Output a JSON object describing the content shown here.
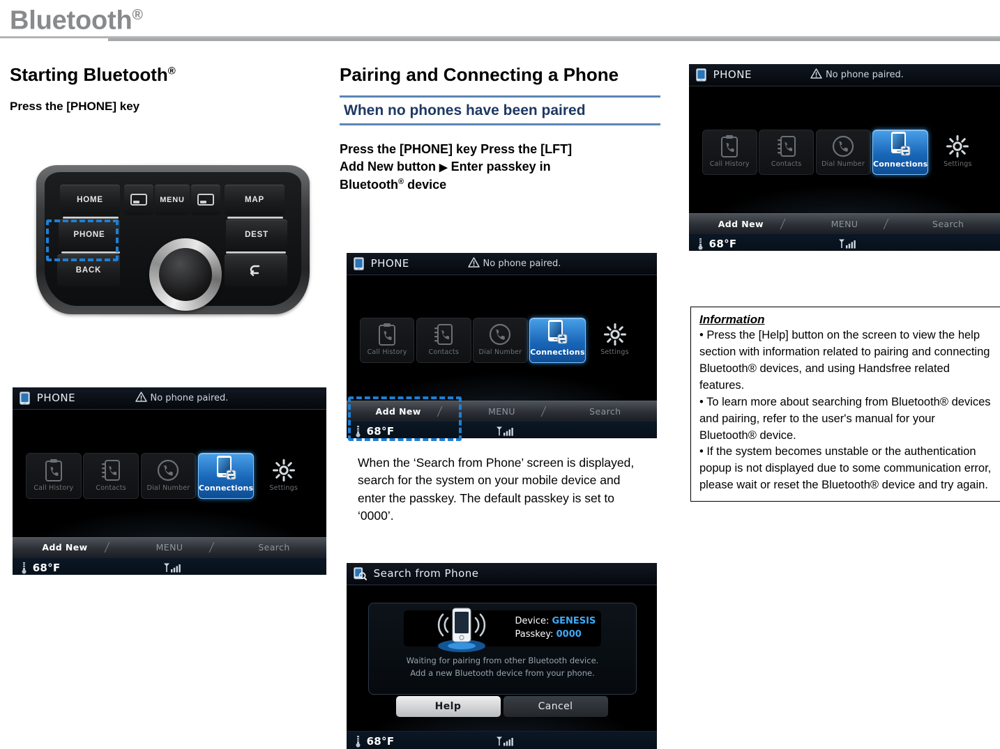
{
  "header": {
    "title": "Bluetooth",
    "reg": "®"
  },
  "left": {
    "heading": "Starting Bluetooth",
    "heading_reg": "®",
    "note": "Press the [PHONE] key",
    "car_panel": {
      "buttons": [
        {
          "label": "HOME",
          "name": "home-button"
        },
        {
          "label": "PHONE",
          "name": "phone-button",
          "highlighted": true
        },
        {
          "label": "BACK",
          "name": "back-button"
        },
        {
          "label": "MENU",
          "name": "menu-button"
        },
        {
          "label": "MAP",
          "name": "map-button"
        },
        {
          "label": "DEST",
          "name": "dest-button"
        }
      ],
      "highlight_color": "#1f7fd4"
    }
  },
  "middle": {
    "heading": "Pairing and Connecting a Phone",
    "section": "When no phones have been paired",
    "section_color": "#1f3864",
    "rule_color": "#5b85b5",
    "steps": "Press the [PHONE] key Press the [LFT] Add New button ▶ Enter passkey in Bluetooth® device",
    "steps_line1": "Press the [PHONE] key Press the [LFT]",
    "steps_line2a": "Add New button",
    "steps_arrow": "▶",
    "steps_line2b": "Enter passkey in",
    "steps_line3": "Bluetooth",
    "steps_line3_reg": "®",
    "steps_line3b": " device",
    "paragraph": "When the ‘Search from Phone’ screen is displayed, search for the system on your mobile device and enter the passkey. The default passkey is set to ‘0000’."
  },
  "right": {
    "info": {
      "title": "Information",
      "bullets": [
        "• Press the [Help] button on the screen to view the help section with information related to pairing and connecting Bluetooth® devices, and using Handsfree related features.",
        "• To learn more about searching from Bluetooth® devices and pairing, refer to the user's manual for your Bluetooth® device.",
        "• If the system becomes unstable or the authentication popup is not displayed due to some communication error, please wait or reset the Bluetooth® device and try again."
      ]
    }
  },
  "phone_screen": {
    "title": "PHONE",
    "warning": "No phone paired.",
    "tiles": [
      {
        "label": "Call History",
        "icon": "call-history-icon",
        "selected": false
      },
      {
        "label": "Contacts",
        "icon": "contacts-icon",
        "selected": false
      },
      {
        "label": "Dial Number",
        "icon": "dial-number-icon",
        "selected": false
      },
      {
        "label": "Connections",
        "icon": "connections-icon",
        "selected": true
      },
      {
        "label": "Settings",
        "icon": "settings-gear-icon",
        "selected": false
      }
    ],
    "softkeys": [
      {
        "label": "Add New",
        "active": true
      },
      {
        "label": "MENU",
        "active": false
      },
      {
        "label": "Search",
        "active": false
      }
    ],
    "status": {
      "temperature": "68°F",
      "signal": "signal-bars-icon"
    }
  },
  "search_screen": {
    "title": "Search from Phone",
    "device_label": "Device:",
    "device_value": "GENESIS",
    "passkey_label": "Passkey:",
    "passkey_value": "0000",
    "wait_line1": "Waiting for pairing from other Bluetooth device.",
    "wait_line2": "Add a new Bluetooth device from your phone.",
    "buttons": [
      {
        "label": "Help",
        "primary": true
      },
      {
        "label": "Cancel",
        "primary": false
      }
    ],
    "status": {
      "temperature": "68°F"
    }
  }
}
